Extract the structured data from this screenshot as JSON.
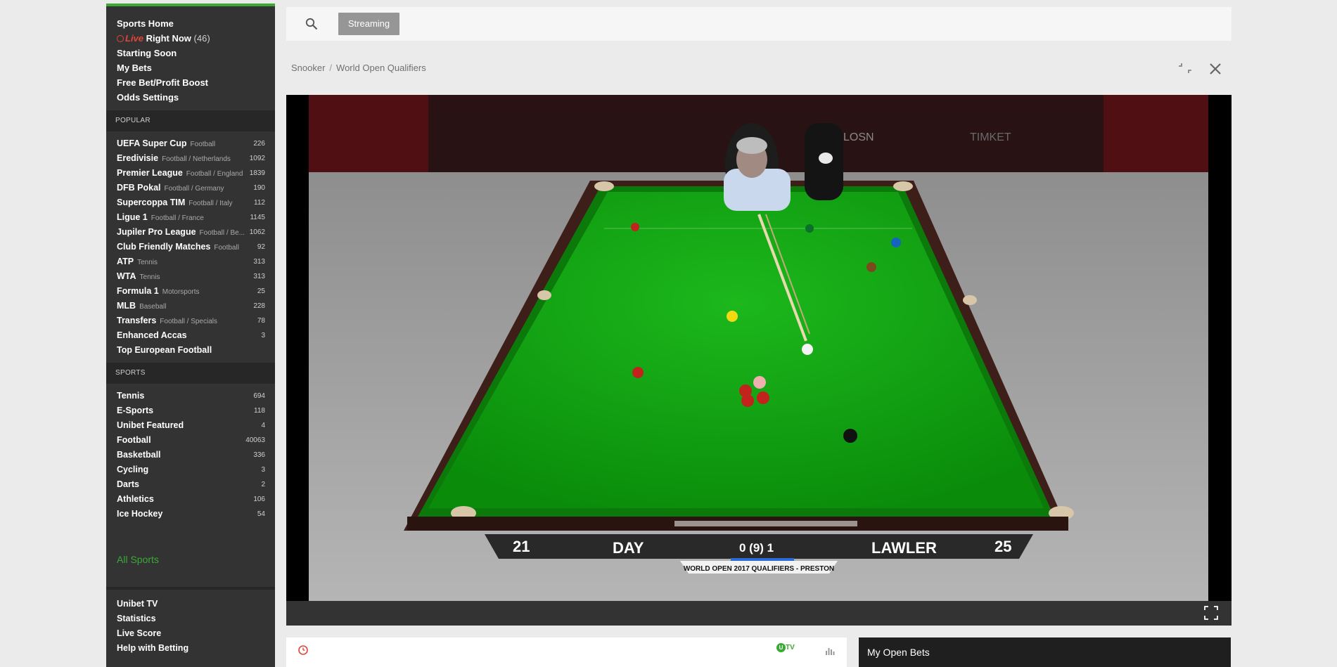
{
  "sidebar": {
    "top_items": [
      {
        "label": "Sports Home"
      },
      {
        "live_word": "Live",
        "label": "Right Now",
        "count": "(46)"
      },
      {
        "label": "Starting Soon"
      },
      {
        "label": "My Bets"
      },
      {
        "label": "Free Bet/Profit Boost"
      },
      {
        "label": "Odds Settings"
      }
    ],
    "popular_header": "POPULAR",
    "popular": [
      {
        "label": "UEFA Super Cup",
        "sub": "Football",
        "count": "226"
      },
      {
        "label": "Eredivisie",
        "sub": "Football / Netherlands",
        "count": "1092"
      },
      {
        "label": "Premier League",
        "sub": "Football / England",
        "count": "1839"
      },
      {
        "label": "DFB Pokal",
        "sub": "Football / Germany",
        "count": "190"
      },
      {
        "label": "Supercoppa TIM",
        "sub": "Football / Italy",
        "count": "112"
      },
      {
        "label": "Ligue 1",
        "sub": "Football / France",
        "count": "1145"
      },
      {
        "label": "Jupiler Pro League",
        "sub": "Football / Be...",
        "count": "1062"
      },
      {
        "label": "Club Friendly Matches",
        "sub": "Football",
        "count": "92"
      },
      {
        "label": "ATP",
        "sub": "Tennis",
        "count": "313"
      },
      {
        "label": "WTA",
        "sub": "Tennis",
        "count": "313"
      },
      {
        "label": "Formula 1",
        "sub": "Motorsports",
        "count": "25"
      },
      {
        "label": "MLB",
        "sub": "Baseball",
        "count": "228"
      },
      {
        "label": "Transfers",
        "sub": "Football / Specials",
        "count": "78"
      },
      {
        "label": "Enhanced Accas",
        "sub": "",
        "count": "3"
      },
      {
        "label": "Top European Football",
        "sub": "",
        "count": ""
      }
    ],
    "sports_header": "SPORTS",
    "sports": [
      {
        "label": "Tennis",
        "count": "694"
      },
      {
        "label": "E-Sports",
        "count": "118"
      },
      {
        "label": "Unibet Featured",
        "count": "4"
      },
      {
        "label": "Football",
        "count": "40063"
      },
      {
        "label": "Basketball",
        "count": "336"
      },
      {
        "label": "Cycling",
        "count": "3"
      },
      {
        "label": "Darts",
        "count": "2"
      },
      {
        "label": "Athletics",
        "count": "106"
      },
      {
        "label": "Ice Hockey",
        "count": "54"
      }
    ],
    "all_sports": "All Sports",
    "bottom": [
      {
        "label": "Unibet TV"
      },
      {
        "label": "Statistics"
      },
      {
        "label": "Live Score"
      },
      {
        "label": "Help with Betting"
      }
    ]
  },
  "topbar": {
    "search_icon": "search-icon",
    "streaming_label": "Streaming"
  },
  "breadcrumb": {
    "sport": "Snooker",
    "separator": "/",
    "event": "World Open Qualifiers"
  },
  "video": {
    "score_left_frames": "21",
    "player_left": "DAY",
    "frame_score": "0 (9) 1",
    "player_right": "LAWLER",
    "score_right_frames": "25",
    "event_banner": "WORLD OPEN 2017 QUALIFIERS - PRESTON",
    "board_text_1": "LOSN",
    "board_text_2": "TIMKET"
  },
  "event_panel": {
    "tv_label": "TV",
    "tv_circle": "U"
  },
  "open_bets": {
    "title": "My Open Bets"
  },
  "colors": {
    "accent_green": "#3aaa35",
    "live_red": "#e0453b",
    "sidebar_bg": "#333333",
    "table_green": "#0f9a10"
  }
}
